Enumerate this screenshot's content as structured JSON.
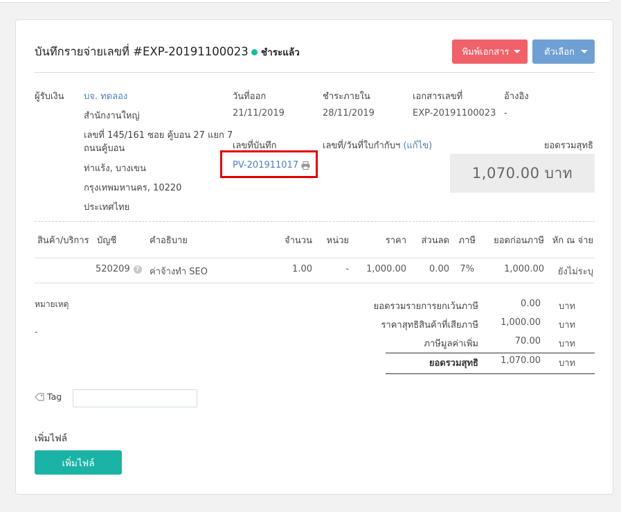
{
  "header": {
    "title": "บันทึกรายจ่ายเลขที่ #EXP-20191100023",
    "status": "ชำระแล้ว",
    "print_button": "พิมพ์เอกสาร",
    "options_button": "ตัวเลือก"
  },
  "payee": {
    "label": "ผู้รับเงิน",
    "name": "บจ. ทดลอง",
    "branch": "สำนักงานใหญ่",
    "address_line1": "เลขที่ 145/161 ซอย คู้บอน 27 แยก 7",
    "address_line2": "ถนนคู้บอน",
    "address_line3": "ท่าแร้ง, บางเขน",
    "address_line4": "กรุงเทพมหานคร, 10220",
    "country": "ประเทศไทย"
  },
  "meta": {
    "issue_date_label": "วันที่ออก",
    "issue_date": "21/11/2019",
    "due_label": "ชำระภายใน",
    "due_date": "28/11/2019",
    "doc_no_label": "เอกสารเลขที่",
    "doc_no": "EXP-20191100023",
    "ref_label": "อ้างอิง",
    "ref_value": "-",
    "record_no_label": "เลขที่บันทึก",
    "record_no": "PV-201911017",
    "tax_invoice_label": "เลขที่/วันที่ใบกำกับฯ",
    "edit_link": "(แก้ไข)",
    "net_total_label": "ยอดรวมสุทธิ",
    "net_total": "1,070.00 บาท"
  },
  "table": {
    "headers": [
      "สินค้า/บริการ",
      "บัญชี",
      "คำอธิบาย",
      "จำนวน",
      "หน่วย",
      "ราคา",
      "ส่วนลด",
      "ภาษี",
      "ยอดก่อนภาษี",
      "หัก ณ จ่าย"
    ],
    "rows": [
      {
        "product": "",
        "account": "520209",
        "description": "ค่าจ้างทำ SEO",
        "quantity": "1.00",
        "unit": "-",
        "price": "1,000.00",
        "discount": "0.00",
        "tax": "7%",
        "pretax": "1,000.00",
        "withholding": "ยังไม่ระบุ"
      }
    ]
  },
  "notes": {
    "label": "หมายเหตุ",
    "value": "-"
  },
  "summary": {
    "rows": [
      {
        "label": "ยอดรวมรายการยกเว้นภาษี",
        "value": "0.00",
        "unit": "บาท"
      },
      {
        "label": "ราคาสุทธิสินค้าที่เสียภาษี",
        "value": "1,000.00",
        "unit": "บาท"
      },
      {
        "label": "ภาษีมูลค่าเพิ่ม",
        "value": "70.00",
        "unit": "บาท"
      }
    ],
    "total": {
      "label": "ยอดรวมสุทธิ",
      "value": "1,070.00",
      "unit": "บาท"
    }
  },
  "tag": {
    "label": "Tag",
    "value": ""
  },
  "attachments": {
    "heading": "เพิ่มไฟล์",
    "button": "เพิ่มไฟล์"
  },
  "colors": {
    "print_button": "#f0616a",
    "options_button": "#6ea0d4",
    "add_file_button": "#1ab3a5",
    "status_dot": "#1abc9c",
    "link": "#4a7fbf",
    "highlight_box": "#e00000"
  }
}
